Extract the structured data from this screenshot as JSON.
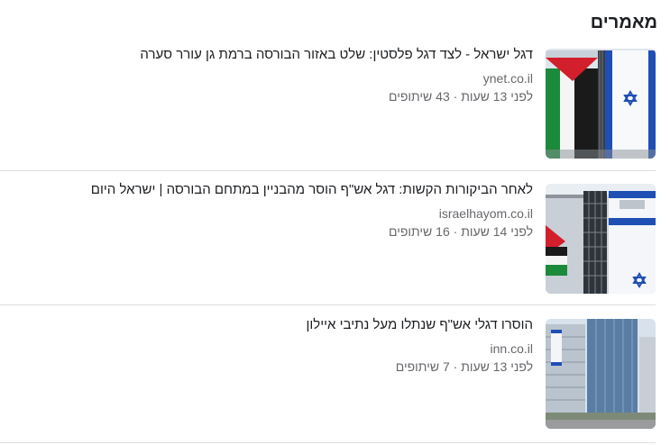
{
  "section": {
    "title": "מאמרים"
  },
  "articles": [
    {
      "headline": "דגל ישראל - לצד דגל פלסטין: שלט באזור הבורסה ברמת גן עורר סערה",
      "source": "ynet.co.il",
      "meta": "לפני 13 שעות · 43 שיתופים",
      "thumbnail": "israel-and-palestine-flags-on-building-image"
    },
    {
      "headline": "לאחר הביקורות הקשות: דגל אש\"ף הוסר מהבניין במתחם הבורסה | ישראל היום",
      "source": "israelhayom.co.il",
      "meta": "לפני 14 שעות · 16 שיתופים",
      "thumbnail": "flags-on-building-facade-image"
    },
    {
      "headline": "הוסרו דגלי אש\"ף שנתלו מעל נתיבי איילון",
      "source": "inn.co.il",
      "meta": "לפני 13 שעות · 7 שיתופים",
      "thumbnail": "towers-near-highway-image"
    }
  ],
  "colors": {
    "text_primary": "#1c1e21",
    "text_secondary": "#65676b",
    "divider": "#dadde1",
    "israel_blue": "#1f4fb4",
    "palestine_red": "#d21f2b",
    "palestine_green": "#1b8a3a"
  }
}
